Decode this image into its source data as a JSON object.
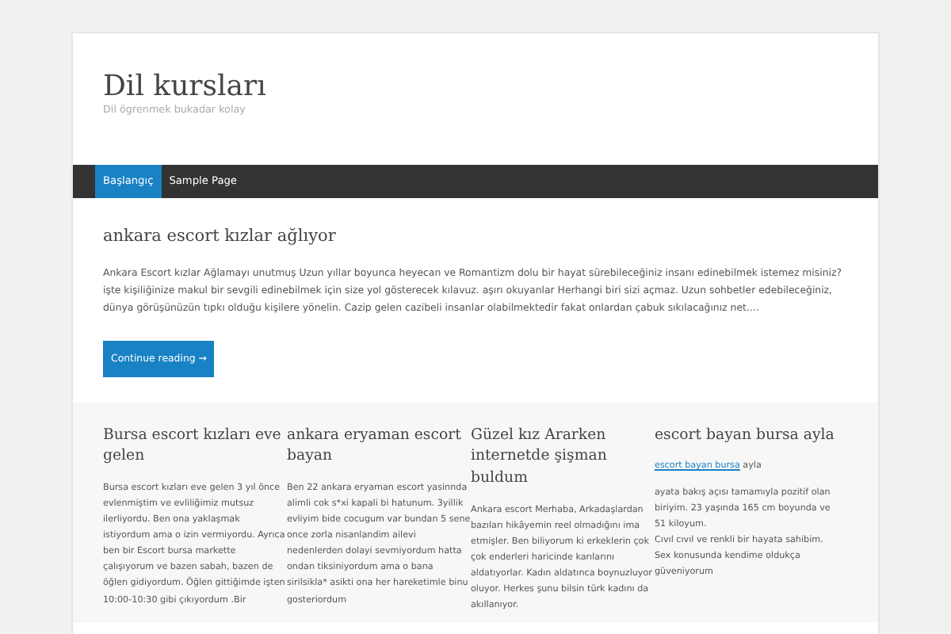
{
  "site": {
    "title": "Dil kursları",
    "tagline": "Dil ögrenmek bukadar kolay"
  },
  "nav": [
    {
      "label": "Başlangıç",
      "selected": true
    },
    {
      "label": "Sample Page",
      "selected": false
    }
  ],
  "post": {
    "title": "ankara escort kızlar ağlıyor",
    "excerpt": "Ankara Escort kızlar Ağlamayı unutmuş Uzun yıllar boyunca heyecan ve Romantizm dolu bir hayat sürebileceğiniz insanı edinebilmek istemez misiniz? işte kişiliğinize makul bir sevgili edinebilmek için size yol gösterecek kılavuz. aşırı okuyanlar Herhangi biri sizi açmaz. Uzun sohbetler edebileceğiniz, dünya görüşünüzün tıpkı olduğu kişilere yönelin. Cazip gelen cazibeli insanlar olabilmektedir fakat onlardan çabuk sıkılacağınız net….",
    "button": "Continue reading →"
  },
  "widgets": [
    {
      "title": "Bursa escort kızları eve gelen",
      "paragraphs": [
        {
          "kind": "text",
          "lines": [
            "Bursa escort kızları eve gelen 3 yıl önce evlenmiştim ve evliliğimiz mutsuz ilerliyordu. Ben ona yaklaşmak istiyordum ama o izin vermiyordu. Ayrıca ben bir Escort bursa markette çalışıyorum ve bazen sabah, bazen de öğlen gidiyordum. Öğlen gittiğimde işten 10:00-10:30 gibi çıkıyordum .Bir"
          ]
        }
      ]
    },
    {
      "title": "ankara eryaman escort bayan",
      "paragraphs": [
        {
          "kind": "text",
          "lines": [
            "Ben 22  ankara eryaman escort yasinnda alimli cok s*xi kapali bi hatunum. 3yillik evliyim bide cocugum var bundan 5 sene once zorla nisanlandim ailevi nedenlerden dolayi sevmiyordum hatta ondan tiksiniyordum ama o bana sirilsikla* asikti ona her hareketimle binu gosteriordum"
          ]
        }
      ]
    },
    {
      "title": "Güzel kız Ararken internetde şişman buldum",
      "paragraphs": [
        {
          "kind": "text",
          "lines": [
            "Ankara escort Merhaba, Arkadaşlardan bazıları hikâyemin reel olmadığını ima etmişler. Ben biliyorum ki erkeklerin çok çok enderleri haricinde karılarını aldatıyorlar. Kadın aldatınca boynuzluyor oluyor. Herkes şunu bilsin türk kadını da akıllanıyor."
          ]
        }
      ]
    },
    {
      "title": "escort bayan bursa ayla",
      "paragraphs": [
        {
          "kind": "link",
          "link": "escort bayan bursa",
          "rest": "ayla"
        },
        {
          "kind": "text",
          "lines": [
            "ayata bakış açısı tamamıyla pozitif olan biriyim. 23 yaşında 165 cm boyunda ve 51 kiloyum.",
            "Cıvıl cıvıl ve renkli bir hayata sahibim. Sex konusunda kendime oldukça güveniyorum"
          ]
        }
      ]
    }
  ]
}
